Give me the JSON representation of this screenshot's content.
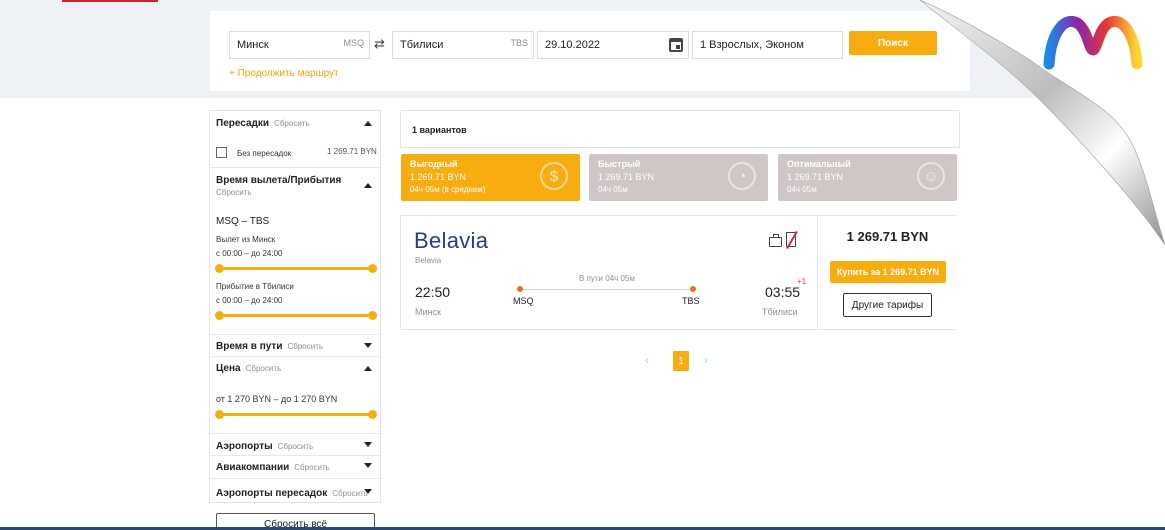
{
  "search": {
    "from_city": "Минск",
    "from_code": "MSQ",
    "to_city": "Тбилиси",
    "to_code": "TBS",
    "date": "29.10.2022",
    "passengers": "1 Взрослых, Эконом",
    "search_label": "Поиск",
    "continue_route": "+ Продолжить маршрут"
  },
  "filters": {
    "transfers": {
      "title": "Пересадки",
      "reset": "Сбросить",
      "option_label": "Без пересадок",
      "option_price": "1 269.71 BYN"
    },
    "times": {
      "title": "Время вылета/Прибытия",
      "reset": "Сбросить",
      "route": "MSQ – TBS",
      "departure_label": "Вылет из Минск",
      "departure_range": "с 00:00 – до 24:00",
      "arrival_label": "Прибытие в Тбилиси",
      "arrival_range": "с 00:00 – до 24:00"
    },
    "duration": {
      "title": "Время в пути",
      "reset": "Сбросить"
    },
    "price": {
      "title": "Цена",
      "reset": "Сбросить",
      "range": "от 1 270 BYN – до 1 270 BYN"
    },
    "airports": {
      "title": "Аэропорты",
      "reset": "Сбросить"
    },
    "airlines": {
      "title": "Авиакомпании",
      "reset": "Сбросить"
    },
    "transfer_airports": {
      "title": "Аэропорты пересадок",
      "reset": "Сбросить"
    },
    "reset_all": "Сбросить всё"
  },
  "results": {
    "count": "1 вариантов",
    "tabs": [
      {
        "name": "Выгодный",
        "price": "1 269.71 BYN",
        "info": "04ч 05м (в среднем)"
      },
      {
        "name": "Быстрый",
        "price": "1 269.71 BYN",
        "info": "04ч 05м"
      },
      {
        "name": "Оптимальный",
        "price": "1 269.71 BYN",
        "info": "04ч 05м"
      }
    ],
    "flight": {
      "airline_logo": "Belavia",
      "airline_name": "Belavia",
      "departure_time": "22:50",
      "departure_city": "Минск",
      "departure_code": "MSQ",
      "arrival_time": "03:55",
      "arrival_day_offset": "+1",
      "arrival_city": "Тбилиси",
      "arrival_code": "TBS",
      "duration": "В пути 04ч 05м",
      "price": "1 269.71 BYN",
      "buy_label": "Купить за 1 269.71 BYN",
      "other_tariffs_label": "Другие тарифы"
    },
    "pager": {
      "prev": "‹",
      "current": "1",
      "next": "›"
    }
  },
  "colors": {
    "accent": "#f7ad0f",
    "tab_inactive": "#cfc6c6",
    "airline": "#2b3a8f"
  }
}
